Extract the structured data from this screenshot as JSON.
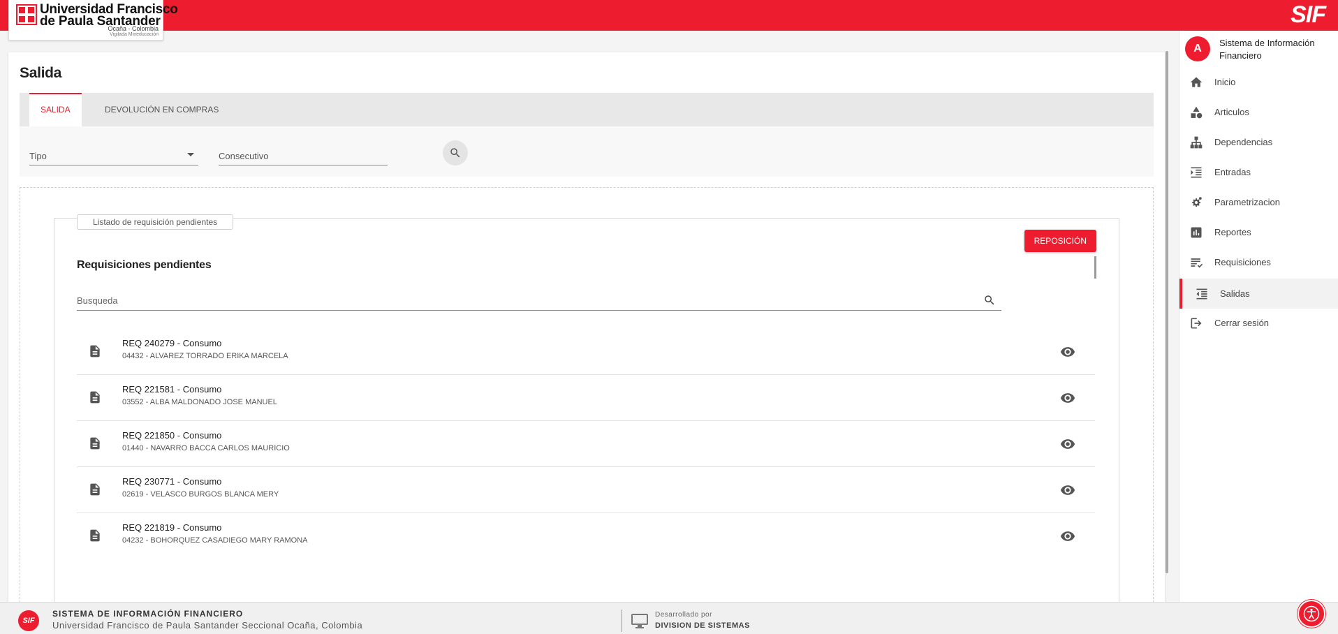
{
  "header": {
    "logo_line1": "Universidad Francisco",
    "logo_line2": "de Paula Santander",
    "logo_line3": "Ocaña - Colombia",
    "logo_line4": "Vigilada Mineducación",
    "logo_mark": "UFPS",
    "brand": "SIF",
    "brand_color": "#ed1c2e"
  },
  "page": {
    "title": "Salida",
    "tabs": [
      {
        "label": "SALIDA",
        "active": true
      },
      {
        "label": "DEVOLUCIÓN EN COMPRAS",
        "active": false
      }
    ],
    "filters": {
      "tipo_label": "Tipo",
      "consecutivo_label": "Consecutivo"
    },
    "legend": "Listado de requisición pendientes",
    "action_button": "REPOSICIÓN",
    "section_title": "Requisiciones pendientes",
    "search_placeholder": "Busqueda",
    "requisitions": [
      {
        "code": "REQ 240279",
        "type": "Consumo",
        "detail": "04432 - ALVAREZ TORRADO ERIKA MARCELA"
      },
      {
        "code": "REQ 221581",
        "type": "Consumo",
        "detail": "03552 - ALBA MALDONADO JOSE MANUEL"
      },
      {
        "code": "REQ 221850",
        "type": "Consumo",
        "detail": "01440 - NAVARRO BACCA CARLOS MAURICIO"
      },
      {
        "code": "REQ 230771",
        "type": "Consumo",
        "detail": "02619 - VELASCO BURGOS BLANCA MERY"
      },
      {
        "code": "REQ 221819",
        "type": "Consumo",
        "detail": "04232 - BOHORQUEZ CASADIEGO MARY RAMONA"
      }
    ]
  },
  "sidebar": {
    "avatar_letter": "A",
    "system_name": "Sistema de Información Financiero",
    "items": [
      {
        "label": "Inicio",
        "icon": "home-icon",
        "active": false
      },
      {
        "label": "Articulos",
        "icon": "shapes-icon",
        "active": false
      },
      {
        "label": "Dependencias",
        "icon": "sitemap-icon",
        "active": false
      },
      {
        "label": "Entradas",
        "icon": "format-indent-increase-icon",
        "active": false
      },
      {
        "label": "Parametrizacion",
        "icon": "settings-gears-icon",
        "active": false
      },
      {
        "label": "Reportes",
        "icon": "bar-chart-icon",
        "active": false
      },
      {
        "label": "Requisiciones",
        "icon": "checklist-icon",
        "active": false
      },
      {
        "label": "Salidas",
        "icon": "format-indent-decrease-icon",
        "active": true
      },
      {
        "label": "Cerrar sesión",
        "icon": "logout-icon",
        "active": false
      }
    ]
  },
  "footer": {
    "logo": "SIF",
    "title": "SISTEMA DE INFORMACIÓN FINANCIERO",
    "subtitle": "Universidad Francisco de Paula Santander Seccional Ocaña, Colombia",
    "dev_label": "Desarrollado por",
    "dev_name": "DIVISION DE SISTEMAS"
  }
}
